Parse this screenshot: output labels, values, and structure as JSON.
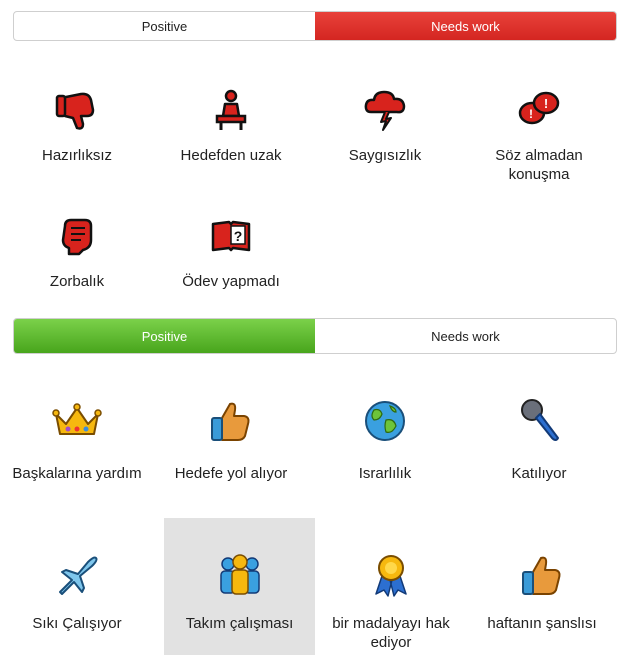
{
  "top_toggle": {
    "positive_label": "Positive",
    "needs_work_label": "Needs work",
    "active": "needs_work"
  },
  "needs_work_items": [
    {
      "label": "Hazırlıksız",
      "icon": "thumbs-down-icon"
    },
    {
      "label": "Hedefden uzak",
      "icon": "person-at-desk-icon"
    },
    {
      "label": "Saygısızlık",
      "icon": "storm-cloud-icon"
    },
    {
      "label": "Söz almadan konuşma",
      "icon": "speech-bubbles-icon"
    },
    {
      "label": "Zorbalık",
      "icon": "fist-icon"
    },
    {
      "label": "Ödev yapmadı",
      "icon": "question-book-icon"
    }
  ],
  "bottom_toggle": {
    "positive_label": "Positive",
    "needs_work_label": "Needs work",
    "active": "positive"
  },
  "positive_items": [
    {
      "label": "Başkalarına yardım",
      "icon": "crown-icon"
    },
    {
      "label": "Hedefe yol alıyor",
      "icon": "thumbs-up-icon"
    },
    {
      "label": "Israrlılık",
      "icon": "globe-icon"
    },
    {
      "label": "Katılıyor",
      "icon": "microphone-icon"
    },
    {
      "label": "Sıkı Çalışıyor",
      "icon": "airplane-icon"
    },
    {
      "label": "Takım çalışması",
      "icon": "team-icon"
    },
    {
      "label": "bir madalyayı hak ediyor",
      "icon": "medal-ribbon-icon"
    },
    {
      "label": "haftanın şanslısı",
      "icon": "thumbs-up-icon"
    }
  ],
  "selected_item": "Takım çalışması",
  "colors": {
    "needs_work_accent": "#d42621",
    "positive_accent": "#48a51c"
  }
}
